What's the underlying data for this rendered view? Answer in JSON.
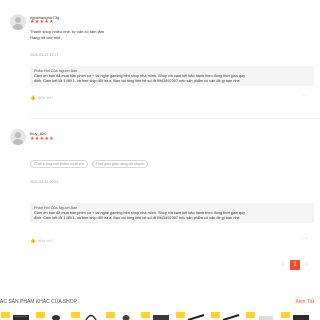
{
  "reviews": [
    {
      "username": "ngokhanghiz73g",
      "stars": "★★★★★",
      "text_lines": [
        "Thanh shop nhiều nhé, tư vấn có tâm lắm",
        "Hàng tốt oke nhé"
      ],
      "date": "2020-03-13 17:27",
      "seller_reply": {
        "title": "Phản Hồi Của Người Bán",
        "lines": [
          "Cảm ơn bạn đã mua bàn phím cơ + tai nghe gaming bên shop nhà mình. Shop xin cam kết bảo hành theo đúng thời gian quy",
          "định. Cam kết lỗi 1 đổi 1, và free ship đổi trả ạ. Bạn vui lòng liên hệ số đt 0943492307 nếu sản phẩm có vấn đề gì bạn nhé"
        ]
      },
      "helpful_label": "Hữu ích?",
      "more_label": "..."
    },
    {
      "username": "thuy_820",
      "stars": "★★★★★",
      "tags": [
        "Chất lượng sản phẩm tuyệt vời",
        "Thời gian giao hàng rất nhanh"
      ],
      "date": "2020-04-22 09:51",
      "seller_reply": {
        "title": "Phản Hồi Của Người Bán",
        "lines": [
          "Cảm ơn bạn đã mua bàn phím cơ + tai nghe gaming bên shop nhà mình. Shop xin cam kết bảo hành theo đúng thời gian quy",
          "định. Cam kết lỗi 1 đổi 1, và free ship đổi trả ạ. Bạn vui lòng liên hệ số đt 0943492307 nếu sản phẩm có vấn đề gì bạn nhé"
        ]
      },
      "helpful_label": "Hữu ích?",
      "more_label": "..."
    }
  ],
  "pagination": {
    "prev": "‹",
    "current": "1",
    "next": "›"
  },
  "other_products": {
    "title": "ÁC SẢN PHẨM KHÁC CỦA SHOP",
    "view_all": "Xem Tất",
    "items": [
      {
        "badge_color": "#ffd424",
        "icon": "keyboard-product-thumbnail"
      },
      {
        "badge_color": "#ffd424",
        "icon": "mouse-product-thumbnail"
      },
      {
        "badge_color": "#ffd424",
        "icon": "headset-product-thumbnail"
      },
      {
        "badge_color": "#ffd424",
        "icon": "mouse-product-thumbnail"
      },
      {
        "badge_color": "#ffd424",
        "icon": "keyboard-product-thumbnail"
      },
      {
        "badge_color": "#ffd424",
        "icon": "keyboard-product-thumbnail"
      },
      {
        "badge_color": "#ffd424",
        "icon": "keyboard-product-thumbnail"
      },
      {
        "badge_color": "#ffd424",
        "icon": "product-thumbnail"
      },
      {
        "badge_color": "#ffd424",
        "icon": "keyboard-product-thumbnail"
      }
    ]
  },
  "colors": {
    "accent": "#ee4d2d",
    "badge": "#ffd424",
    "reply_bg": "#f5f5f5"
  }
}
